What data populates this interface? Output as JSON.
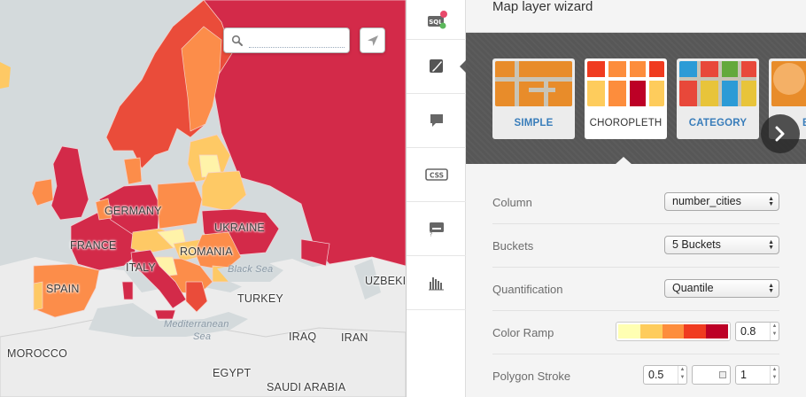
{
  "map": {
    "search": {
      "placeholder": "",
      "value": ""
    },
    "labels": {
      "germany": "GERMANY",
      "ukraine": "UKRAINE",
      "france": "FRANCE",
      "romania": "ROMANIA",
      "italy": "ITALY",
      "black_sea": "Black Sea",
      "spain": "SPAIN",
      "turkey": "TURKEY",
      "uzbekistan": "UZBEKIS",
      "mediterranean_1": "Mediterranean",
      "mediterranean_2": "Sea",
      "iraq": "IRAQ",
      "iran": "IRAN",
      "morocco": "MOROCCO",
      "egypt": "EGYPT",
      "saudi_arabia": "SAUDI ARABIA"
    },
    "colors": {
      "bucket_1": "#fff3a9",
      "bucket_2": "#fec965",
      "bucket_3": "#fc8d4a",
      "bucket_4": "#ea4c3a",
      "bucket_5": "#d32a49",
      "water": "#d4dadc",
      "nodata_land": "#ececec"
    }
  },
  "toolbar": {
    "items": [
      {
        "name": "sql",
        "icon": "sql-icon",
        "badges": [
          "#e8486a",
          "#5cb85c"
        ]
      },
      {
        "name": "wizard",
        "icon": "paintbrush-icon",
        "active": true
      },
      {
        "name": "infowindow",
        "icon": "speech-bubble-icon"
      },
      {
        "name": "css",
        "icon": "css-icon",
        "label": "CSS"
      },
      {
        "name": "legend",
        "icon": "legend-icon"
      },
      {
        "name": "filters",
        "icon": "histogram-icon"
      }
    ]
  },
  "panel": {
    "title": "Map layer wizard",
    "wizards": [
      {
        "label": "SIMPLE",
        "selected": false
      },
      {
        "label": "CHOROPLETH",
        "selected": true
      },
      {
        "label": "CATEGORY",
        "selected": false
      },
      {
        "label": "BU",
        "selected": false
      }
    ],
    "form": {
      "column": {
        "label": "Column",
        "value": "number_cities"
      },
      "buckets": {
        "label": "Buckets",
        "value": "5 Buckets"
      },
      "quantification": {
        "label": "Quantification",
        "value": "Quantile"
      },
      "color_ramp": {
        "label": "Color Ramp",
        "colors": [
          "#ffffb2",
          "#fecc5c",
          "#fd8d3c",
          "#f03b20",
          "#bd0026"
        ],
        "opacity": "0.8"
      },
      "polygon_stroke": {
        "label": "Polygon Stroke",
        "width": "0.5",
        "opacity": "1"
      }
    }
  }
}
